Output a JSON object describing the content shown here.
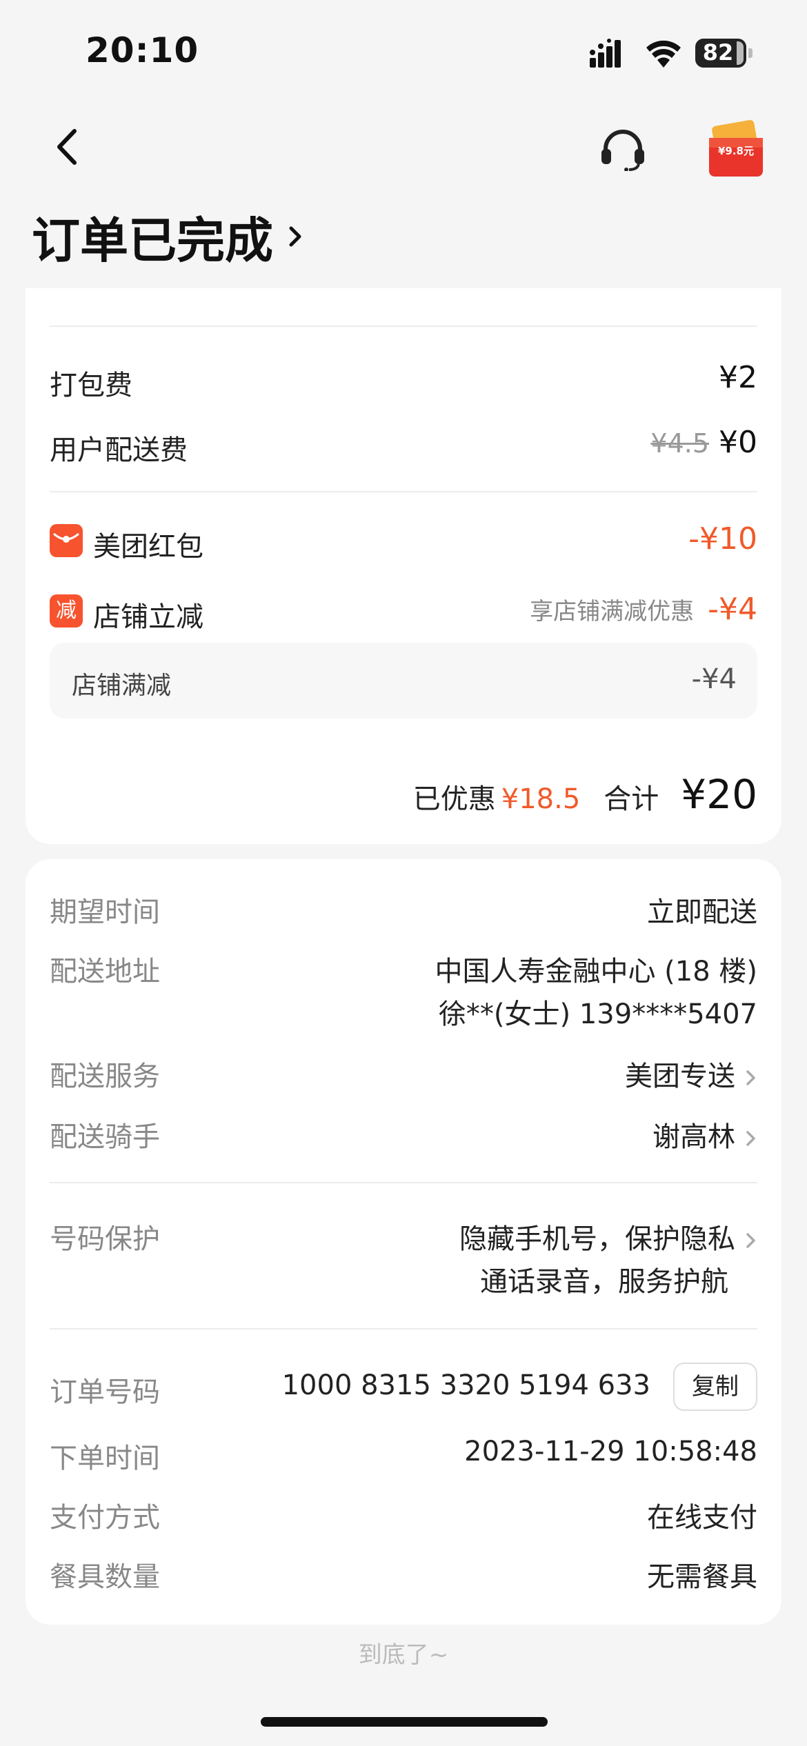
{
  "status_bar": {
    "time": "20:10",
    "battery": "82"
  },
  "nav": {
    "promo_badge_text": "¥9.8元"
  },
  "title": "订单已完成",
  "fees": {
    "packing_label": "打包费",
    "packing_value": "¥2",
    "delivery_label": "用户配送费",
    "delivery_original": "¥4.5",
    "delivery_value": "¥0"
  },
  "discounts": {
    "redpacket_icon": "red-envelope-icon",
    "redpacket_label": "美团红包",
    "redpacket_value": "-¥10",
    "shop_icon_text": "减",
    "shop_label": "店铺立减",
    "shop_hint": "享店铺满减优惠",
    "shop_value": "-¥4",
    "sub_label": "店铺满减",
    "sub_value": "-¥4"
  },
  "total": {
    "saved_label": "已优惠",
    "saved_value": "¥18.5",
    "total_label": "合计",
    "total_value": "¥20"
  },
  "delivery_info": {
    "expected_label": "期望时间",
    "expected_value": "立即配送",
    "address_label": "配送地址",
    "address_line1": "中国人寿金融中心 (18 楼)",
    "address_line2": "徐**(女士) 139****5407",
    "service_label": "配送服务",
    "service_value": "美团专送",
    "rider_label": "配送骑手",
    "rider_value": "谢高林"
  },
  "privacy": {
    "label": "号码保护",
    "line1": "隐藏手机号，保护隐私",
    "line2": "通话录音，服务护航"
  },
  "order": {
    "number_label": "订单号码",
    "number_value": "1000 8315 3320 5194 633",
    "copy_label": "复制",
    "time_label": "下单时间",
    "time_value": "2023-11-29 10:58:48",
    "pay_label": "支付方式",
    "pay_value": "在线支付",
    "tableware_label": "餐具数量",
    "tableware_value": "无需餐具"
  },
  "footer": "到底了~",
  "colors": {
    "accent_red": "#f05a2a",
    "tag_red": "#f7532e"
  }
}
